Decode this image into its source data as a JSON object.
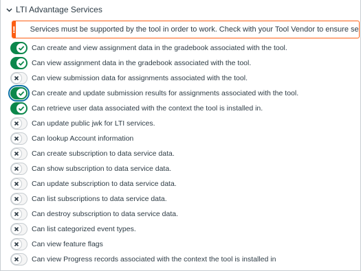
{
  "section": {
    "title": "LTI Advantage Services"
  },
  "alert": {
    "icon": "!",
    "message": "Services must be supported by the tool in order to work. Check with your Tool Vendor to ensure service capabilities."
  },
  "services": [
    {
      "label": "Can create and view assignment data in the gradebook associated with the tool.",
      "enabled": true
    },
    {
      "label": "Can view assignment data in the gradebook associated with the tool.",
      "enabled": true
    },
    {
      "label": "Can view submission data for assignments associated with the tool.",
      "enabled": false
    },
    {
      "label": "Can create and update submission results for assignments associated with the tool.",
      "enabled": true,
      "focused": true
    },
    {
      "label": "Can retrieve user data associated with the context the tool is installed in.",
      "enabled": true
    },
    {
      "label": "Can update public jwk for LTI services.",
      "enabled": false
    },
    {
      "label": "Can lookup Account information",
      "enabled": false
    },
    {
      "label": "Can create subscription to data service data.",
      "enabled": false
    },
    {
      "label": "Can show subscription to data service data.",
      "enabled": false
    },
    {
      "label": "Can update subscription to data service data.",
      "enabled": false
    },
    {
      "label": "Can list subscriptions to data service data.",
      "enabled": false
    },
    {
      "label": "Can destroy subscription to data service data.",
      "enabled": false
    },
    {
      "label": "Can list categorized event types.",
      "enabled": false
    },
    {
      "label": "Can view feature flags",
      "enabled": false
    },
    {
      "label": "Can view Progress records associated with the context the tool is installed in",
      "enabled": false
    }
  ],
  "colors": {
    "on": "#0b874b",
    "alert": "#fc5e13",
    "off_x": "#2d3b45"
  }
}
